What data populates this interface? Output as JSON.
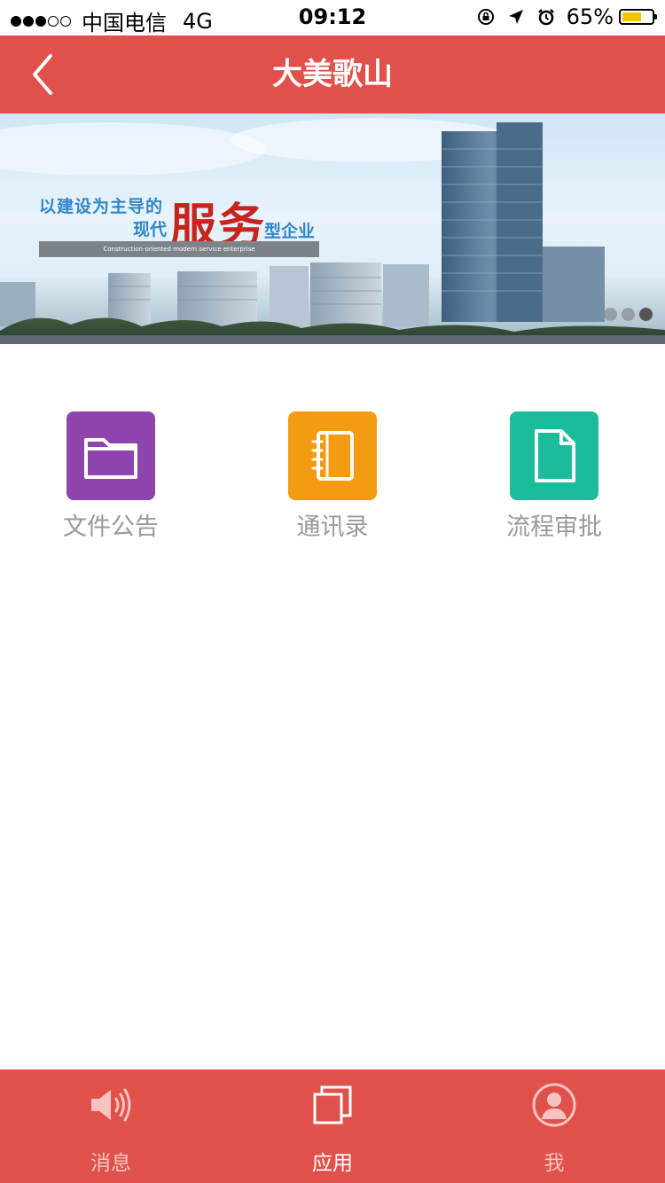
{
  "status_bar": {
    "signal_strength": 3,
    "carrier": "中国电信",
    "network": "4G",
    "time": "09:12",
    "icons": [
      "rotation-lock-icon",
      "location-arrow-icon",
      "alarm-icon"
    ],
    "battery_percent": "65%",
    "battery_level": 0.65
  },
  "nav": {
    "back_icon": "chevron-left-icon",
    "title": "大美歌山"
  },
  "banner": {
    "line1": "以建设为主导的",
    "line2": "现代",
    "emphasis": "服务",
    "line3": "型企业",
    "subtitle": "Construction-oriented modern service enterprise",
    "page_count": 3,
    "active_page": 3
  },
  "apps": [
    {
      "label": "文件公告",
      "icon": "folder-icon",
      "color": "#8e44ad"
    },
    {
      "label": "通讯录",
      "icon": "notebook-icon",
      "color": "#f39c12"
    },
    {
      "label": "流程审批",
      "icon": "document-icon",
      "color": "#1abc9c"
    }
  ],
  "tabs": [
    {
      "label": "消息",
      "icon": "speaker-icon",
      "active": false
    },
    {
      "label": "应用",
      "icon": "apps-icon",
      "active": true
    },
    {
      "label": "我",
      "icon": "user-icon",
      "active": false
    }
  ],
  "colors": {
    "primary": "#e0514c",
    "tab_inactive": "#f6c3c0",
    "label_gray": "#9a9a9a"
  }
}
